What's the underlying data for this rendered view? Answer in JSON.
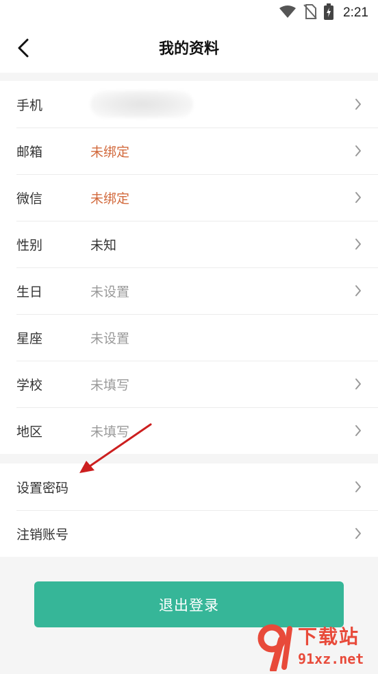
{
  "status_bar": {
    "time": "2:21",
    "icons": [
      "wifi-icon",
      "no-sim-icon",
      "battery-charging-icon"
    ]
  },
  "header": {
    "title": "我的资料",
    "back_icon": "chevron-left-icon"
  },
  "profile": {
    "rows": [
      {
        "label": "手机",
        "value": "",
        "blurred": true
      },
      {
        "label": "邮箱",
        "value": "未绑定",
        "color": "#d2693c"
      },
      {
        "label": "微信",
        "value": "未绑定",
        "color": "#d2693c"
      },
      {
        "label": "性别",
        "value": "未知"
      },
      {
        "label": "生日",
        "value": "未设置"
      },
      {
        "label": "星座",
        "value": "未设置"
      },
      {
        "label": "学校",
        "value": "未填写"
      },
      {
        "label": "地区",
        "value": "未填写"
      }
    ]
  },
  "account": {
    "rows": [
      {
        "label": "设置密码"
      },
      {
        "label": "注销账号"
      }
    ]
  },
  "logout": {
    "label": "退出登录",
    "color": "#36b698"
  },
  "watermark": {
    "title": "下载站",
    "url": "91xz.net",
    "logo_text": "91"
  },
  "colors": {
    "accent": "#36b698",
    "warning": "#d2693c",
    "annotation_arrow": "#cc1f1f"
  }
}
